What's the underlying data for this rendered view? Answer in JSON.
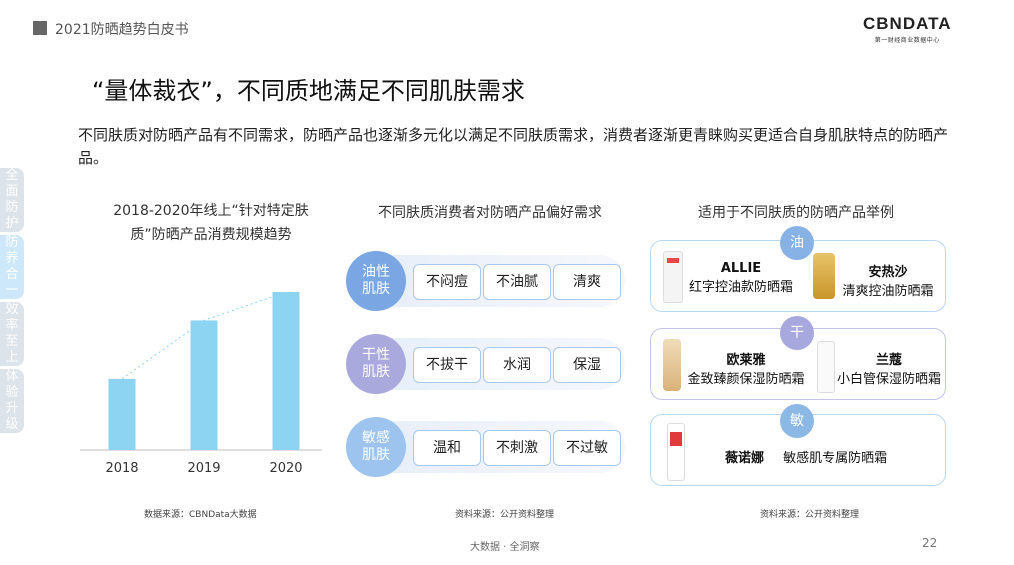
{
  "header": {
    "report_title": "2021防晒趋势白皮书",
    "logo_text": "CBNDATA",
    "logo_subtitle": "第一财经商业数据中心"
  },
  "headline": "“量体裁衣”，不同质地满足不同肌肤需求",
  "intro": "不同肤质对防晒产品有不同需求，防晒产品也逐渐多元化以满足不同肤质需求，消费者逐渐更青睐购买更适合自身肌肤特点的防晒产品。",
  "side_tabs": [
    {
      "label": "全面防护",
      "active": false
    },
    {
      "label": "防养合一",
      "active": true
    },
    {
      "label": "效率至上",
      "active": false
    },
    {
      "label": "体验升级",
      "active": false
    }
  ],
  "chart_data": {
    "type": "bar",
    "title": "2018-2020年线上“针对特定肤质”防晒产品消费规模趋势",
    "categories": [
      "2018",
      "2019",
      "2020"
    ],
    "values": [
      0.45,
      0.82,
      1.0
    ],
    "trendline": true,
    "color": "#8dd3f2",
    "grid": false
  },
  "chart_source": "数据来源：CBNData大数据",
  "preferences": {
    "title": "不同肤质消费者对防晒产品偏好需求",
    "rows": [
      {
        "skin": "油性\n肌肤",
        "color": "#7aa6e3",
        "items": [
          "不闷痘",
          "不油腻",
          "清爽"
        ]
      },
      {
        "skin": "干性\n肌肤",
        "color": "#a9a9dd",
        "items": [
          "不拔干",
          "水润",
          "保湿"
        ]
      },
      {
        "skin": "敏感\n肌肤",
        "color": "#9cc4ee",
        "items": [
          "温和",
          "不刺激",
          "不过敏"
        ]
      }
    ],
    "source": "资料来源：公开资料整理"
  },
  "examples": {
    "title": "适用于不同肤质的防晒产品举例",
    "cards": [
      {
        "tag": "油",
        "tag_color": "#86b2e6",
        "border": "#b9d8f3",
        "products": [
          {
            "brand": "ALLIE",
            "name": "红字控油款防晒霜"
          },
          {
            "brand": "安热沙",
            "name": "清爽控油防晒霜"
          }
        ]
      },
      {
        "tag": "干",
        "tag_color": "#a7a8dd",
        "border": "#c4c4ea",
        "products": [
          {
            "brand": "欧莱雅",
            "name": "金致臻颜保湿防晒霜"
          },
          {
            "brand": "兰蔻",
            "name": "小白管保湿防晒霜"
          }
        ]
      },
      {
        "tag": "敏",
        "tag_color": "#8cb8e6",
        "border": "#b9d8f3",
        "products": [
          {
            "brand": "薇诺娜",
            "name": "敏感肌专属防晒霜"
          }
        ]
      }
    ],
    "source": "资料来源：公开资料整理"
  },
  "footer": {
    "text": "大数据 · 全洞察",
    "page": "22"
  }
}
